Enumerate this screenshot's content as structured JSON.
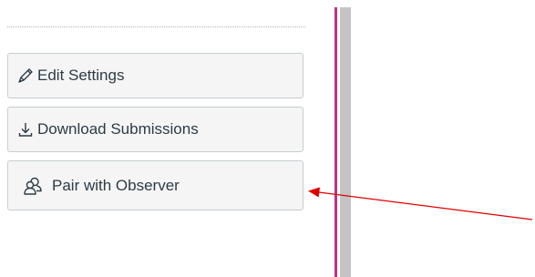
{
  "sidebar": {
    "actions": [
      {
        "label": "Edit Settings",
        "icon": "pencil-icon"
      },
      {
        "label": "Download Submissions",
        "icon": "download-icon"
      },
      {
        "label": "Pair with Observer",
        "icon": "users-icon"
      }
    ]
  },
  "colors": {
    "button_bg": "#f5f5f5",
    "button_border": "#c7cdd1",
    "text": "#2d3b45",
    "page_edge": "#b9318f",
    "annotation_arrow": "#e00000"
  }
}
